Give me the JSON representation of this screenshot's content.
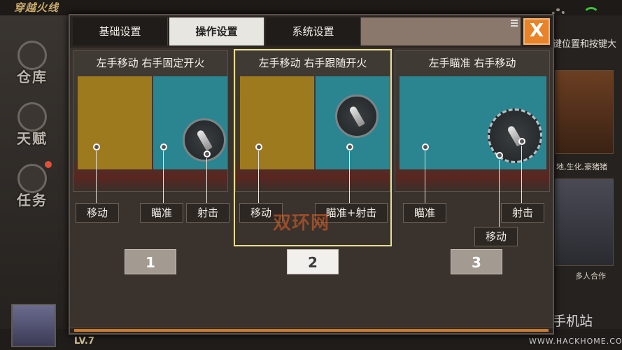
{
  "background": {
    "game_logo": "穿越火线",
    "sidebar": [
      {
        "label": "仓库"
      },
      {
        "label": "天赋"
      },
      {
        "label": "任务"
      }
    ],
    "right_hint": "键位置和按键大",
    "card1_text": "地,生化,豪猪猪",
    "card2_text": "多人合作",
    "level": "LV.7",
    "watermark_site": "网侠手机站",
    "watermark_url": "WWW.HACKHOME.COM"
  },
  "dialog": {
    "tabs": [
      "基础设置",
      "操作设置",
      "系统设置"
    ],
    "active_tab": "操作设置",
    "close_label": "X",
    "panels": [
      {
        "title": "左手移动 右手固定开火",
        "labels": [
          "移动",
          "瞄准",
          "射击"
        ]
      },
      {
        "title": "左手移动 右手跟随开火",
        "labels": [
          "移动",
          "瞄准+射击"
        ]
      },
      {
        "title": "左手瞄准 右手移动",
        "labels": [
          "瞄准",
          "射击",
          "移动"
        ]
      }
    ],
    "options": [
      "1",
      "2",
      "3"
    ],
    "selected_option": "2",
    "watermark": "双环网"
  }
}
